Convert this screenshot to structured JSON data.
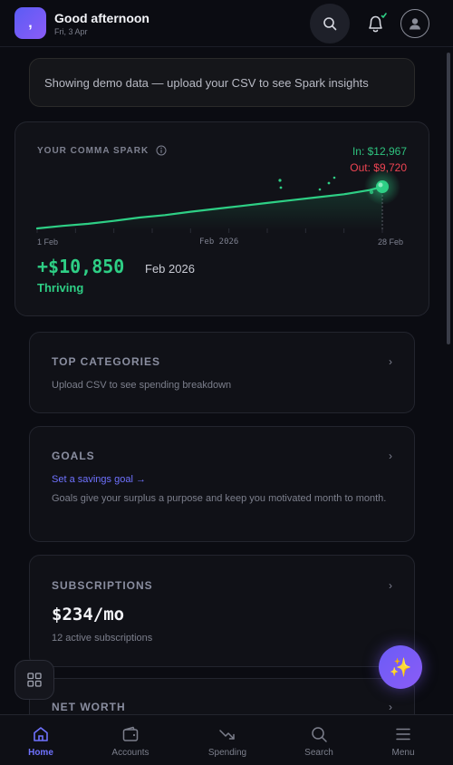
{
  "header": {
    "logo_glyph": ",",
    "greeting": "Good afternoon",
    "date": "Fri, 3 Apr",
    "icons": [
      "search-icon",
      "bell-icon",
      "user-icon"
    ],
    "accent": "#6f72ff"
  },
  "demo_banner": {
    "text": "Showing demo data — upload your CSV to see Spark insights"
  },
  "spark": {
    "title": "YOUR COMMA SPARK",
    "in_label": "In: $12,967",
    "out_label": "Out: $9,720",
    "tick_start": "1 Feb",
    "tick_mid": "Feb 2026",
    "tick_end": "28 Feb",
    "net_value": "+$10,850",
    "net_month": "Feb 2026",
    "status": "Thriving",
    "line_color": "#2ecf85",
    "out_color": "#ef4452"
  },
  "chart_data": {
    "type": "line",
    "x": [
      1,
      3,
      5,
      7,
      9,
      11,
      13,
      15,
      17,
      19,
      21,
      23,
      25,
      27,
      28
    ],
    "series": [
      {
        "values": [
          0,
          0.06,
          0.11,
          0.18,
          0.26,
          0.32,
          0.4,
          0.47,
          0.54,
          0.61,
          0.68,
          0.75,
          0.82,
          0.92,
          1
        ]
      }
    ],
    "xlabel": "",
    "ylabel": ""
  },
  "cards": {
    "top_categories": {
      "title": "TOP CATEGORIES",
      "text": "Upload CSV to see spending breakdown"
    },
    "goals": {
      "title": "GOALS",
      "link": "Set a savings goal →",
      "text": "Goals give your surplus a purpose and keep you motivated month to month."
    },
    "subscriptions": {
      "title": "SUBSCRIPTIONS",
      "amount": "$234/mo",
      "text": "12 active subscriptions"
    },
    "net_worth": {
      "title": "NET WORTH"
    },
    "chevron": "›"
  },
  "fab": {
    "ai_glyph": "✨"
  },
  "nav": {
    "items": [
      {
        "label": "Home",
        "icon": "home-icon"
      },
      {
        "label": "Accounts",
        "icon": "wallet-icon"
      },
      {
        "label": "Spending",
        "icon": "trend-down-icon"
      },
      {
        "label": "Search",
        "icon": "search-icon"
      },
      {
        "label": "Menu",
        "icon": "menu-icon"
      }
    ],
    "active": "Home"
  }
}
